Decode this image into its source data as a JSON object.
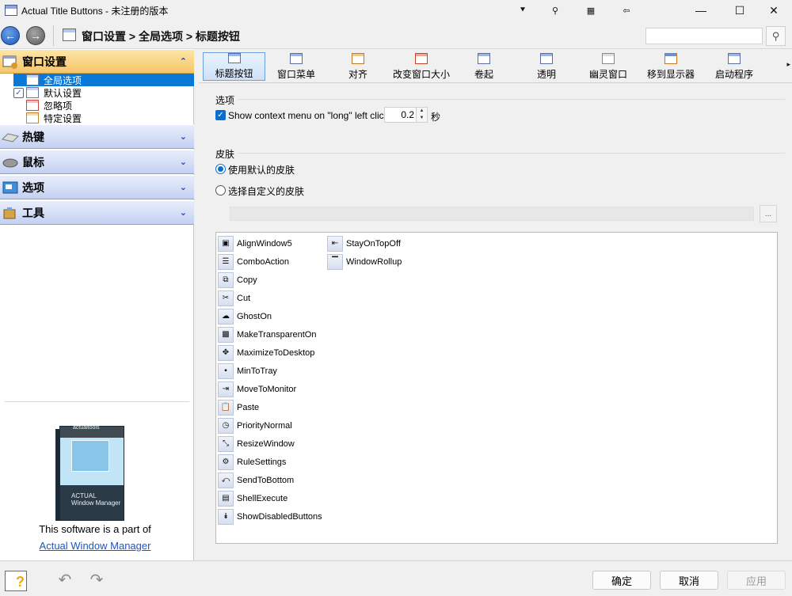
{
  "window": {
    "title": "Actual Title Buttons - 未注册的版本",
    "extra_buttons": [
      "⯆",
      "⚲",
      "▦",
      "⇦"
    ],
    "controls": {
      "minimize": "—",
      "maximize": "☐",
      "close": "✕"
    }
  },
  "nav": {
    "back_glyph": "←",
    "forward_glyph": "→",
    "breadcrumb": "窗口设置 > 全局选项 > 标题按钮",
    "search": {
      "value": "",
      "placeholder": ""
    },
    "search_glyph": "⚲"
  },
  "sidebar": {
    "categories": [
      {
        "label": "窗口设置",
        "chevron": "⌃",
        "icon": "window-settings-icon"
      },
      {
        "label": "热键",
        "chevron": "⌄",
        "icon": "keyboard-icon"
      },
      {
        "label": "鼠标",
        "chevron": "⌄",
        "icon": "mouse-icon"
      },
      {
        "label": "选项",
        "chevron": "⌄",
        "icon": "options-icon"
      },
      {
        "label": "工具",
        "chevron": "⌄",
        "icon": "tools-icon"
      }
    ],
    "tree": [
      {
        "label": "全局选项",
        "selected": true
      },
      {
        "label": "默认设置",
        "checked": true
      },
      {
        "label": "忽略项"
      },
      {
        "label": "特定设置"
      }
    ],
    "promo": {
      "box_logo": "actualtools",
      "box_name_line1": "ACTUAL",
      "box_name_line2": "Window Manager",
      "text": "This software is a part of",
      "link": "Actual Window Manager"
    }
  },
  "toolbar": {
    "tools": [
      "标题按钮",
      "窗口菜单",
      "对齐",
      "改变窗口大小",
      "卷起",
      "透明",
      "幽灵窗口",
      "移到显示器",
      "启动程序"
    ],
    "active_index": 0,
    "more_glyph": "▸"
  },
  "options": {
    "group_label": "选项",
    "long_click_label": "Show context menu on \"long\" left click",
    "long_click_checked": true,
    "delay_value": "0.2",
    "delay_unit": "秒"
  },
  "skin": {
    "group_label": "皮肤",
    "default_label": "使用默认的皮肤",
    "custom_label": "选择自定义的皮肤",
    "selected": "default",
    "path_value": "",
    "browse_label": "..."
  },
  "buttons_list": {
    "column1": [
      {
        "label": "AlignWindow5",
        "icon": "▣"
      },
      {
        "label": "ComboAction",
        "icon": "☰"
      },
      {
        "label": "Copy",
        "icon": "⧉"
      },
      {
        "label": "Cut",
        "icon": "✂"
      },
      {
        "label": "GhostOn",
        "icon": "☁"
      },
      {
        "label": "MakeTransparentOn",
        "icon": "▩"
      },
      {
        "label": "MaximizeToDesktop",
        "icon": "✥"
      },
      {
        "label": "MinToTray",
        "icon": "▪"
      },
      {
        "label": "MoveToMonitor",
        "icon": "⇥"
      },
      {
        "label": "Paste",
        "icon": "📋"
      },
      {
        "label": "PriorityNormal",
        "icon": "◷"
      },
      {
        "label": "ResizeWindow",
        "icon": "⤡"
      },
      {
        "label": "RuleSettings",
        "icon": "⚙"
      },
      {
        "label": "SendToBottom",
        "icon": "⤺"
      },
      {
        "label": "ShellExecute",
        "icon": "▤"
      },
      {
        "label": "ShowDisabledButtons",
        "icon": "⯯"
      }
    ],
    "column2": [
      {
        "label": "StayOnTopOff",
        "icon": "⇤"
      },
      {
        "label": "WindowRollup",
        "icon": "▔"
      }
    ]
  },
  "footer": {
    "help_glyph": "?",
    "undo_glyph": "↶",
    "redo_glyph": "↷",
    "ok_label": "确定",
    "cancel_label": "取消",
    "apply_label": "应用"
  },
  "colors": {
    "selection": "#0a78d7",
    "link": "#1c55c7",
    "active_category": "#f6c56a",
    "category_gradient": "#c3d1f2"
  }
}
